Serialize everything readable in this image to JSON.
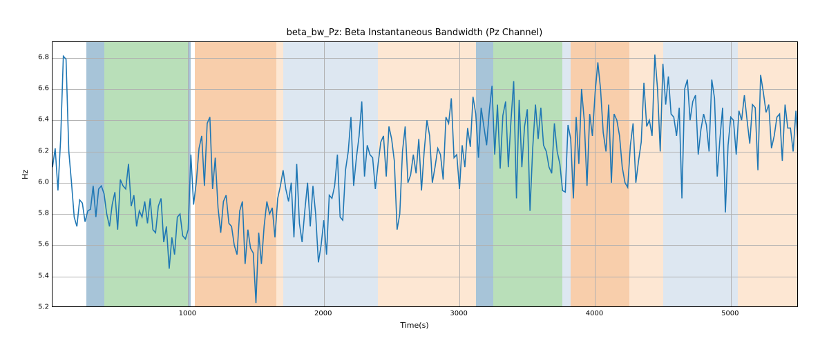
{
  "chart_data": {
    "type": "line",
    "title": "beta_bw_Pz: Beta Instantaneous Bandwidth (Pz Channel)",
    "xlabel": "Time(s)",
    "ylabel": "Hz",
    "xlim": [
      0,
      5500
    ],
    "ylim": [
      5.2,
      6.9
    ],
    "xticks": [
      1000,
      2000,
      3000,
      4000,
      5000
    ],
    "yticks": [
      5.2,
      5.4,
      5.6,
      5.8,
      6.0,
      6.2,
      6.4,
      6.6,
      6.8
    ],
    "bands": [
      {
        "start": 250,
        "end": 380,
        "color": "#a7c4d8"
      },
      {
        "start": 380,
        "end": 1000,
        "color": "#b9dfb9"
      },
      {
        "start": 1000,
        "end": 1020,
        "color": "#a7c4d8"
      },
      {
        "start": 1050,
        "end": 1650,
        "color": "#f8ceab"
      },
      {
        "start": 1650,
        "end": 1700,
        "color": "#fde7d3"
      },
      {
        "start": 1700,
        "end": 2400,
        "color": "#dde7f1"
      },
      {
        "start": 2400,
        "end": 3120,
        "color": "#fde7d3"
      },
      {
        "start": 3120,
        "end": 3250,
        "color": "#a7c4d8"
      },
      {
        "start": 3250,
        "end": 3760,
        "color": "#b9dfb9"
      },
      {
        "start": 3760,
        "end": 3820,
        "color": "#dde7f1"
      },
      {
        "start": 3820,
        "end": 4250,
        "color": "#f8ceab"
      },
      {
        "start": 4250,
        "end": 4500,
        "color": "#fde7d3"
      },
      {
        "start": 4500,
        "end": 5050,
        "color": "#dde7f1"
      },
      {
        "start": 5050,
        "end": 5500,
        "color": "#fde7d3"
      }
    ],
    "x": [
      0,
      20,
      40,
      60,
      80,
      100,
      120,
      140,
      160,
      180,
      200,
      220,
      240,
      260,
      280,
      300,
      320,
      340,
      360,
      380,
      400,
      420,
      440,
      460,
      480,
      500,
      520,
      540,
      560,
      580,
      600,
      620,
      640,
      660,
      680,
      700,
      720,
      740,
      760,
      780,
      800,
      820,
      840,
      860,
      880,
      900,
      920,
      940,
      960,
      980,
      1000,
      1020,
      1040,
      1060,
      1080,
      1100,
      1120,
      1140,
      1160,
      1180,
      1200,
      1220,
      1240,
      1260,
      1280,
      1300,
      1320,
      1340,
      1360,
      1380,
      1400,
      1420,
      1440,
      1460,
      1480,
      1500,
      1520,
      1540,
      1560,
      1580,
      1600,
      1620,
      1640,
      1660,
      1680,
      1700,
      1720,
      1740,
      1760,
      1780,
      1800,
      1820,
      1840,
      1860,
      1880,
      1900,
      1920,
      1940,
      1960,
      1980,
      2000,
      2020,
      2040,
      2060,
      2080,
      2100,
      2120,
      2140,
      2160,
      2180,
      2200,
      2220,
      2240,
      2260,
      2280,
      2300,
      2320,
      2340,
      2360,
      2380,
      2400,
      2420,
      2440,
      2460,
      2480,
      2500,
      2520,
      2540,
      2560,
      2580,
      2600,
      2620,
      2640,
      2660,
      2680,
      2700,
      2720,
      2740,
      2760,
      2780,
      2800,
      2820,
      2840,
      2860,
      2880,
      2900,
      2920,
      2940,
      2960,
      2980,
      3000,
      3020,
      3040,
      3060,
      3080,
      3100,
      3120,
      3140,
      3160,
      3180,
      3200,
      3220,
      3240,
      3260,
      3280,
      3300,
      3320,
      3340,
      3360,
      3380,
      3400,
      3420,
      3440,
      3460,
      3480,
      3500,
      3520,
      3540,
      3560,
      3580,
      3600,
      3620,
      3640,
      3660,
      3680,
      3700,
      3720,
      3740,
      3760,
      3780,
      3800,
      3820,
      3840,
      3860,
      3880,
      3900,
      3920,
      3940,
      3960,
      3980,
      4000,
      4020,
      4040,
      4060,
      4080,
      4100,
      4120,
      4140,
      4160,
      4180,
      4200,
      4220,
      4240,
      4260,
      4280,
      4300,
      4320,
      4340,
      4360,
      4380,
      4400,
      4420,
      4440,
      4460,
      4480,
      4500,
      4520,
      4540,
      4560,
      4580,
      4600,
      4620,
      4640,
      4660,
      4680,
      4700,
      4720,
      4740,
      4760,
      4780,
      4800,
      4820,
      4840,
      4860,
      4880,
      4900,
      4920,
      4940,
      4960,
      4980,
      5000,
      5020,
      5040,
      5060,
      5080,
      5100,
      5120,
      5140,
      5160,
      5180,
      5200,
      5220,
      5240,
      5260,
      5280,
      5300,
      5320,
      5340,
      5360,
      5380,
      5400,
      5420,
      5440,
      5460,
      5480,
      5500
    ],
    "values": [
      6.1,
      6.22,
      5.95,
      6.28,
      6.81,
      6.79,
      6.2,
      6.0,
      5.78,
      5.72,
      5.89,
      5.87,
      5.75,
      5.82,
      5.83,
      5.98,
      5.78,
      5.96,
      5.98,
      5.93,
      5.8,
      5.72,
      5.86,
      5.94,
      5.7,
      6.02,
      5.98,
      5.96,
      6.12,
      5.85,
      5.92,
      5.72,
      5.82,
      5.78,
      5.88,
      5.74,
      5.9,
      5.7,
      5.68,
      5.85,
      5.9,
      5.62,
      5.72,
      5.45,
      5.65,
      5.54,
      5.78,
      5.8,
      5.66,
      5.64,
      5.7,
      6.18,
      5.86,
      6.0,
      6.22,
      6.3,
      5.98,
      6.38,
      6.42,
      5.96,
      6.16,
      5.84,
      5.68,
      5.88,
      5.92,
      5.74,
      5.72,
      5.6,
      5.54,
      5.82,
      5.88,
      5.48,
      5.7,
      5.58,
      5.55,
      5.23,
      5.68,
      5.48,
      5.72,
      5.88,
      5.8,
      5.84,
      5.65,
      5.9,
      5.98,
      6.08,
      5.96,
      5.88,
      6.0,
      5.65,
      6.12,
      5.74,
      5.62,
      5.82,
      6.0,
      5.72,
      5.98,
      5.8,
      5.49,
      5.6,
      5.76,
      5.54,
      5.92,
      5.9,
      5.98,
      6.18,
      5.78,
      5.76,
      6.08,
      6.2,
      6.42,
      5.98,
      6.16,
      6.3,
      6.52,
      6.04,
      6.24,
      6.18,
      6.16,
      5.96,
      6.12,
      6.26,
      6.3,
      6.04,
      6.36,
      6.28,
      6.14,
      5.7,
      5.8,
      6.2,
      6.36,
      6.0,
      6.05,
      6.18,
      6.06,
      6.28,
      5.95,
      6.2,
      6.4,
      6.3,
      6.0,
      6.1,
      6.22,
      6.18,
      6.02,
      6.42,
      6.38,
      6.54,
      6.16,
      6.18,
      5.96,
      6.24,
      6.1,
      6.35,
      6.23,
      6.55,
      6.44,
      6.16,
      6.48,
      6.36,
      6.24,
      6.46,
      6.62,
      6.18,
      6.5,
      6.09,
      6.43,
      6.52,
      6.1,
      6.4,
      6.65,
      5.9,
      6.53,
      6.1,
      6.36,
      6.47,
      5.82,
      6.22,
      6.5,
      6.28,
      6.48,
      6.24,
      6.2,
      6.1,
      6.06,
      6.38,
      6.2,
      6.12,
      5.95,
      5.94,
      6.37,
      6.28,
      5.9,
      6.42,
      6.12,
      6.6,
      6.4,
      5.98,
      6.44,
      6.3,
      6.58,
      6.77,
      6.6,
      6.32,
      6.2,
      6.5,
      6.0,
      6.44,
      6.4,
      6.3,
      6.1,
      6.0,
      5.97,
      6.24,
      6.38,
      6.0,
      6.14,
      6.26,
      6.64,
      6.36,
      6.4,
      6.3,
      6.82,
      6.6,
      6.2,
      6.76,
      6.5,
      6.68,
      6.44,
      6.42,
      6.3,
      6.48,
      5.9,
      6.6,
      6.66,
      6.4,
      6.52,
      6.56,
      6.18,
      6.34,
      6.44,
      6.37,
      6.2,
      6.66,
      6.54,
      6.04,
      6.28,
      6.48,
      5.81,
      6.24,
      6.42,
      6.4,
      6.18,
      6.46,
      6.4,
      6.56,
      6.4,
      6.25,
      6.5,
      6.48,
      6.08,
      6.69,
      6.58,
      6.45,
      6.5,
      6.22,
      6.3,
      6.42,
      6.44,
      6.14,
      6.5,
      6.35,
      6.35,
      6.2,
      6.46,
      6.2
    ]
  },
  "layout": {
    "axes_left": 75,
    "axes_top": 60,
    "axes_width": 1080,
    "axes_height": 385
  }
}
